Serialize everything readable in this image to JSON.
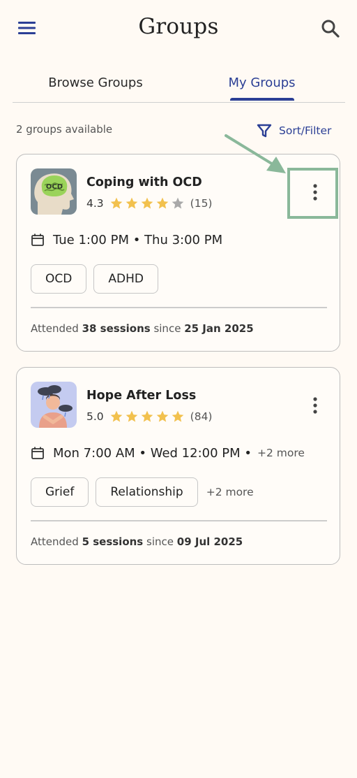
{
  "header": {
    "title": "Groups",
    "menu_icon": "hamburger-menu-icon",
    "search_icon": "search-icon"
  },
  "tabs": [
    {
      "label": "Browse Groups",
      "active": false
    },
    {
      "label": "My Groups",
      "active": true
    }
  ],
  "toolbar": {
    "count_text": "2 groups available",
    "sort_filter_label": "Sort/Filter",
    "filter_icon": "filter-funnel-icon"
  },
  "groups": [
    {
      "title": "Coping with OCD",
      "rating": "4.3",
      "rating_value": 4.3,
      "reviews": "(15)",
      "schedule": "Tue 1:00 PM • Thu 3:00 PM",
      "schedule_more": "",
      "tags": [
        "OCD",
        "ADHD"
      ],
      "tags_more": "",
      "attended_prefix": "Attended",
      "attended_sessions": "38 sessions",
      "attended_since": "since",
      "attended_date": "25 Jan 2025",
      "thumbnail_icon": "head-with-ocd-brain-icon"
    },
    {
      "title": "Hope After Loss",
      "rating": "5.0",
      "rating_value": 5.0,
      "reviews": "(84)",
      "schedule": "Mon 7:00 AM • Wed 12:00 PM •",
      "schedule_more": "+2 more",
      "tags": [
        "Grief",
        "Relationship"
      ],
      "tags_more": "+2 more",
      "attended_prefix": "Attended",
      "attended_sessions": "5 sessions",
      "attended_since": "since",
      "attended_date": "09 Jul 2025",
      "thumbnail_icon": "person-under-clouds-icon"
    }
  ],
  "colors": {
    "accent": "#2b3f95",
    "star": "#f2c14e",
    "star_empty": "#a9a9a9",
    "highlight": "#8ab89a",
    "background": "#fffaf4"
  },
  "annotation": {
    "arrow_icon": "pointer-arrow-icon",
    "highlight_box": "highlight-box"
  }
}
